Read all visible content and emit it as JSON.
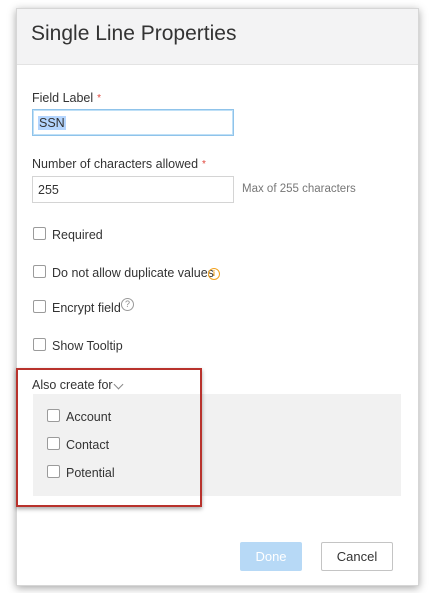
{
  "dialog": {
    "title": "Single Line Properties"
  },
  "field_label": {
    "label": "Field Label",
    "required_marker": "*",
    "value": "SSN"
  },
  "char_limit": {
    "label": "Number of characters allowed",
    "required_marker": "*",
    "value": "255",
    "hint": "Max of 255 characters"
  },
  "options": {
    "required": "Required",
    "no_duplicates": "Do not allow duplicate values",
    "encrypt": "Encrypt field",
    "tooltip": "Show Tooltip"
  },
  "icons": {
    "info": "i",
    "help": "?"
  },
  "also_create": {
    "label": "Also create for",
    "items": [
      "Account",
      "Contact",
      "Potential"
    ]
  },
  "buttons": {
    "done": "Done",
    "cancel": "Cancel"
  },
  "colors": {
    "required_star": "#e0453a",
    "info_icon": "#f1a21f",
    "highlight_border": "#b8322c",
    "done_button": "#b7d9f6",
    "selection": "#b4d5fe"
  }
}
